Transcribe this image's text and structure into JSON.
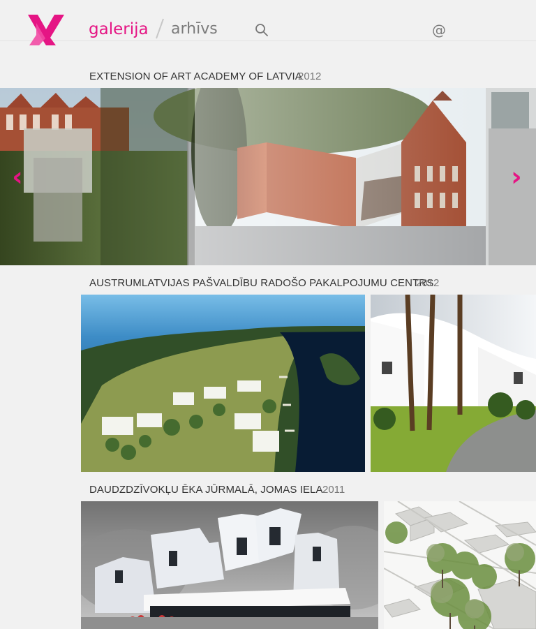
{
  "header": {
    "logo_icon": "ya-logo-icon",
    "nav": {
      "gallery": "galerija",
      "archive": "arhīvs"
    },
    "search_icon": "search-icon",
    "contact_symbol": "@"
  },
  "sections": [
    {
      "title": "EXTENSION OF ART ACADEMY OF LATVIA",
      "year": "2012"
    },
    {
      "title": "AUSTRUMLATVIJAS PAŠVALDĪBU RADOŠO PAKALPOJUMU CENTRS",
      "year": "2012"
    },
    {
      "title": "DAUDZDZĪVOKĻU ĒKA JŪRMALĀ, JOMAS IELA",
      "year": "2011"
    }
  ],
  "carousel": {
    "left_arrow": "‹",
    "right_arrow": "›"
  },
  "colors": {
    "accent": "#e51584",
    "background": "#f1f1f1",
    "text": "#333333",
    "muted": "#777777"
  }
}
